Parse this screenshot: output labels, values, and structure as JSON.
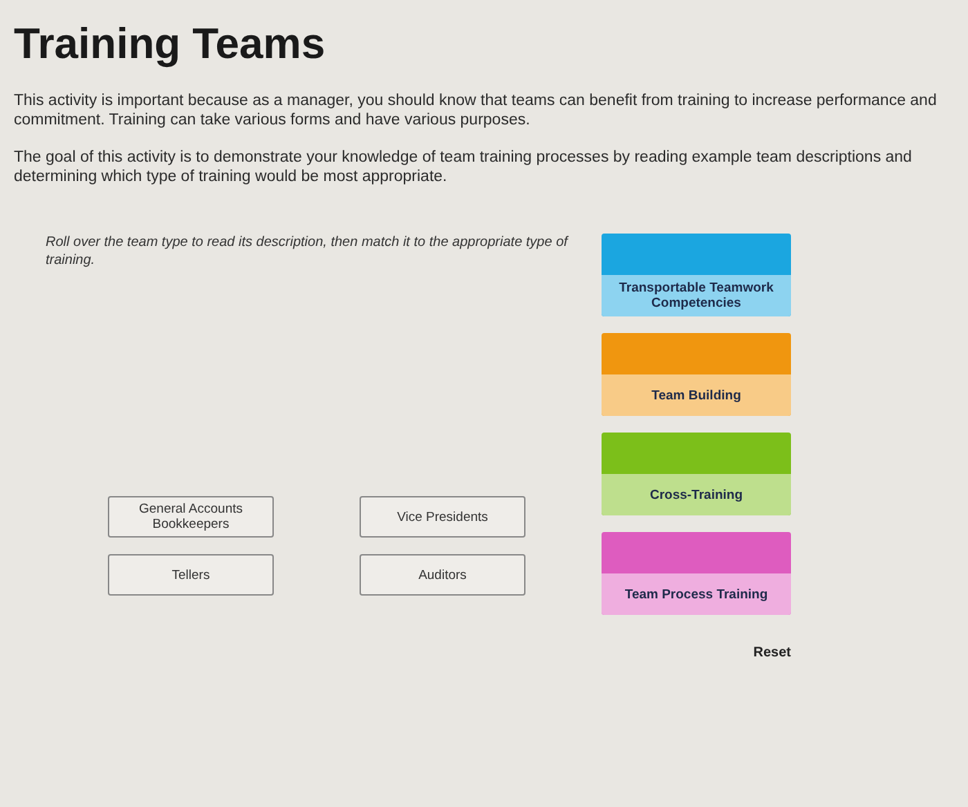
{
  "title": "Training Teams",
  "paragraphs": [
    "This activity is important because as a manager, you should know that teams can benefit from training to increase performance and commitment. Training can take various forms and have various purposes.",
    "The goal of this activity is to demonstrate your knowledge of team training processes by reading example team descriptions and determining which type of training would be most appropriate."
  ],
  "instruction": "Roll over the team type to read its description, then match it to the appropriate type of training.",
  "teams": [
    {
      "label": "General Accounts Bookkeepers"
    },
    {
      "label": "Vice Presidents"
    },
    {
      "label": "Tellers"
    },
    {
      "label": "Auditors"
    }
  ],
  "training_types": [
    {
      "label": "Transportable Teamwork Competencies",
      "color": "#1ba6e0"
    },
    {
      "label": "Team Building",
      "color": "#f0960f"
    },
    {
      "label": "Cross-Training",
      "color": "#7cbf1a"
    },
    {
      "label": "Team Process Training",
      "color": "#de5cbf"
    }
  ],
  "reset": "Reset"
}
